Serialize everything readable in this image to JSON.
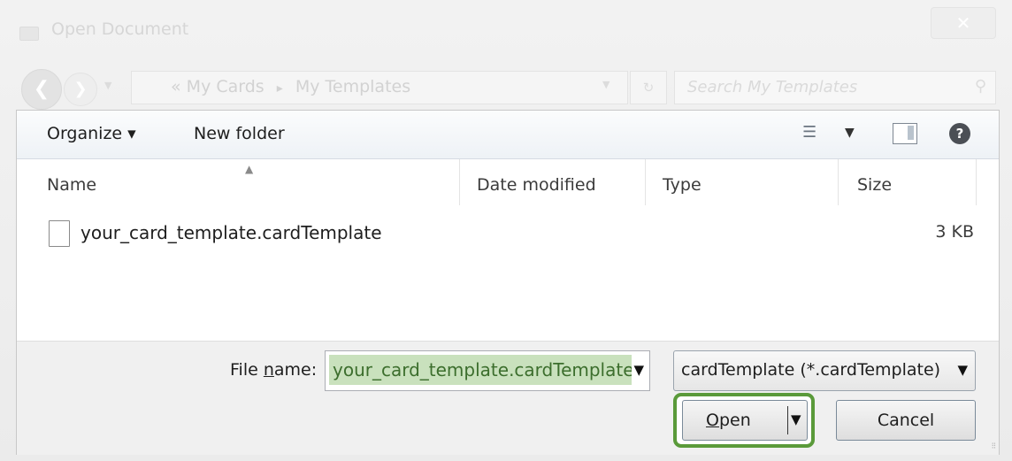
{
  "window": {
    "title": "Open Document",
    "close_glyph": "✕"
  },
  "nav": {
    "back_glyph": "❮",
    "forward_glyph": "❯",
    "breadcrumb_prefix": "«",
    "breadcrumbs": [
      "My Cards",
      "My Templates"
    ],
    "breadcrumb_separator": "▸",
    "search_placeholder": "Search My Templates"
  },
  "toolbar": {
    "organize_label": "Organize ▾",
    "new_folder_label": "New folder",
    "view_icon": "list-view-icon",
    "help_glyph": "?"
  },
  "columns": [
    "Name",
    "Date modified",
    "Type",
    "Size"
  ],
  "files": [
    {
      "name": "your_card_template.cardTemplate",
      "date_modified": "",
      "type": "",
      "size": "3 KB"
    }
  ],
  "footer": {
    "file_name_label_prefix": "File ",
    "file_name_label_mnemonic": "n",
    "file_name_label_suffix": "ame:",
    "file_name_value": "your_card_template.cardTemplate",
    "file_type_value": "cardTemplate (*.cardTemplate)",
    "open_mnemonic": "O",
    "open_rest": "pen",
    "cancel_label": "Cancel"
  },
  "colors": {
    "highlight_border": "#5a9a3a",
    "filename_selection": "#c9e1bd"
  }
}
